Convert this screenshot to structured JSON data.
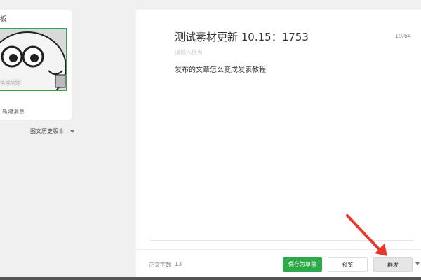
{
  "left": {
    "title": "板",
    "thumb_date": "5.1753",
    "new_message": "新建消息",
    "history": "图文历史版本"
  },
  "editor": {
    "title": "测试素材更新  10.15：1753",
    "counter": "19/64",
    "author_placeholder": "请输入作者",
    "body": "发布的文章怎么变成发表教程"
  },
  "footer": {
    "word_count_label": "正文字数",
    "word_count_value": "13",
    "save_label": "保存为草稿",
    "preview_label": "预览",
    "mass_send_label": "群发"
  },
  "colors": {
    "accent": "#2faa4a",
    "arrow": "#e8392f"
  }
}
